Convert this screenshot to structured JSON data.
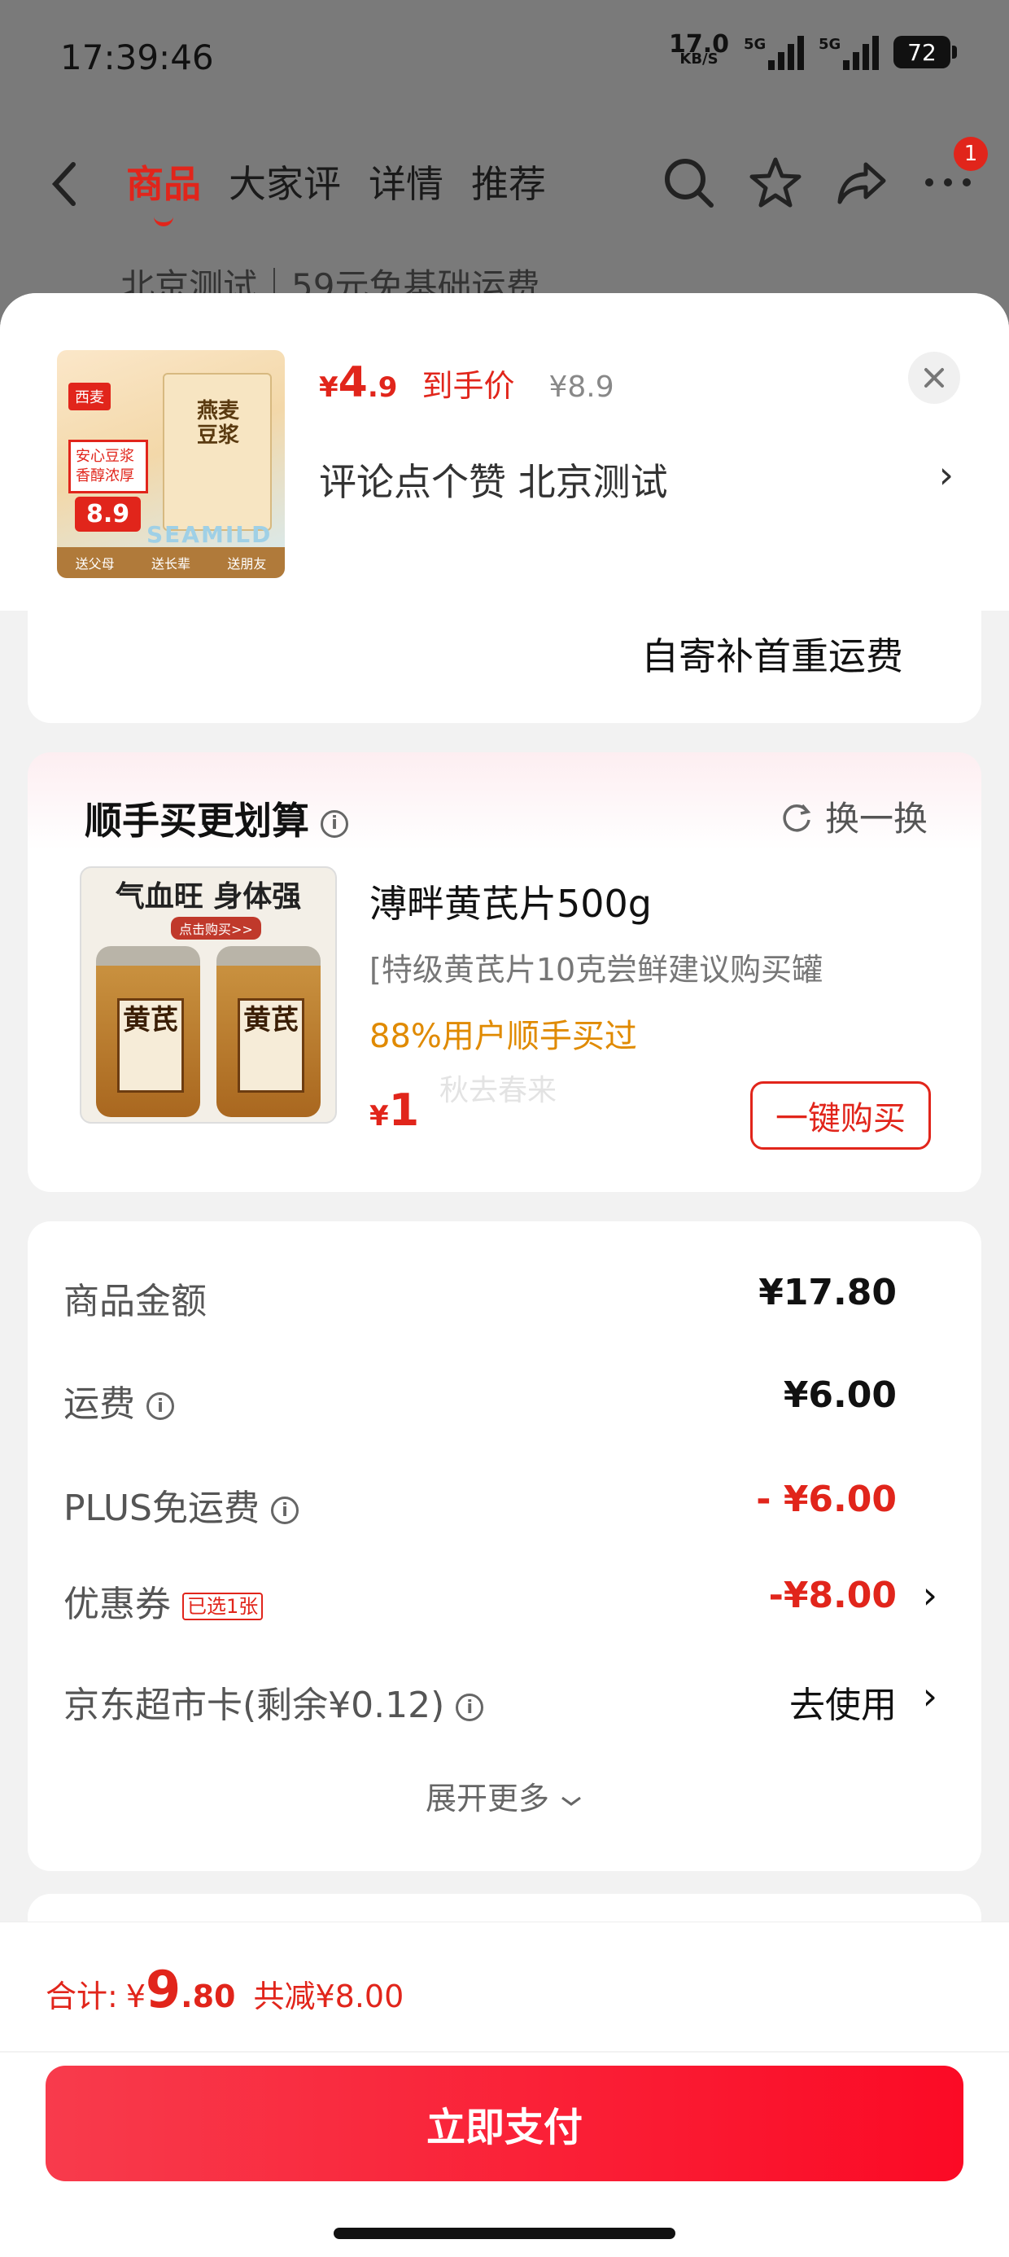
{
  "status_bar": {
    "time": "17:39:46",
    "net_speed": "17.0",
    "net_unit": "KB/S",
    "sim1": "5G",
    "sim2": "5G",
    "battery": "72"
  },
  "nav": {
    "tabs": [
      {
        "label": "商品",
        "active": true
      },
      {
        "label": "大家评",
        "active": false
      },
      {
        "label": "详情",
        "active": false
      },
      {
        "label": "推荐",
        "active": false
      }
    ],
    "icons": [
      "back-icon",
      "search-icon",
      "star-icon",
      "share-icon",
      "more-icon"
    ],
    "badge": "1",
    "behind_text": "北京测试｜59元免基础运费"
  },
  "product": {
    "currency": "¥",
    "price_int": "4",
    "price_dec": ".9",
    "price_label": "到手价",
    "original_price": "¥8.9",
    "address": "评论点个赞  北京测试",
    "address_chevron": "›",
    "image": {
      "brand": "西麦",
      "tag": "安心豆浆 香醇浓厚",
      "price_bubble": "8.9",
      "bag_text": "燕麦豆浆",
      "watermark": "SEAMILD",
      "strip": [
        "送父母",
        "送长辈",
        "送朋友"
      ]
    }
  },
  "shipping_note": "自寄补首重运费",
  "upsell": {
    "title": "顺手买更划算",
    "swap_label": "换一换",
    "image": {
      "headline": "气血旺 身体强",
      "sub": "点击购买>>",
      "jar_label": "黄芪"
    },
    "name": "溥畔黄芪片500g",
    "desc": "[特级黄芪片10克尝鲜建议购买罐",
    "rate": "88%用户顺手买过",
    "currency": "¥",
    "price": "1",
    "watermark": "秋去春来",
    "buy_label": "一键购买"
  },
  "costs": {
    "rows": [
      {
        "label": "商品金额",
        "value": "¥17.80"
      },
      {
        "label": "运费",
        "value": "¥6.00"
      },
      {
        "label": "PLUS免运费",
        "value": "- ¥6.00"
      },
      {
        "label": "优惠券",
        "tag": "已选1张",
        "value": "-¥8.00",
        "arrow": "›"
      },
      {
        "label": "京东超市卡(剩余¥0.12)",
        "value": "去使用",
        "arrow": "›"
      }
    ],
    "expand_label": "展开更多"
  },
  "footer": {
    "total_label": "合计:",
    "currency": "¥",
    "total_int": "9",
    "total_dec": ".80",
    "discount": "共减¥8.00",
    "pay_label": "立即支付"
  },
  "colors": {
    "accent": "#e1251b",
    "pay_button": "#fb0a25",
    "orange": "#e08a00"
  }
}
